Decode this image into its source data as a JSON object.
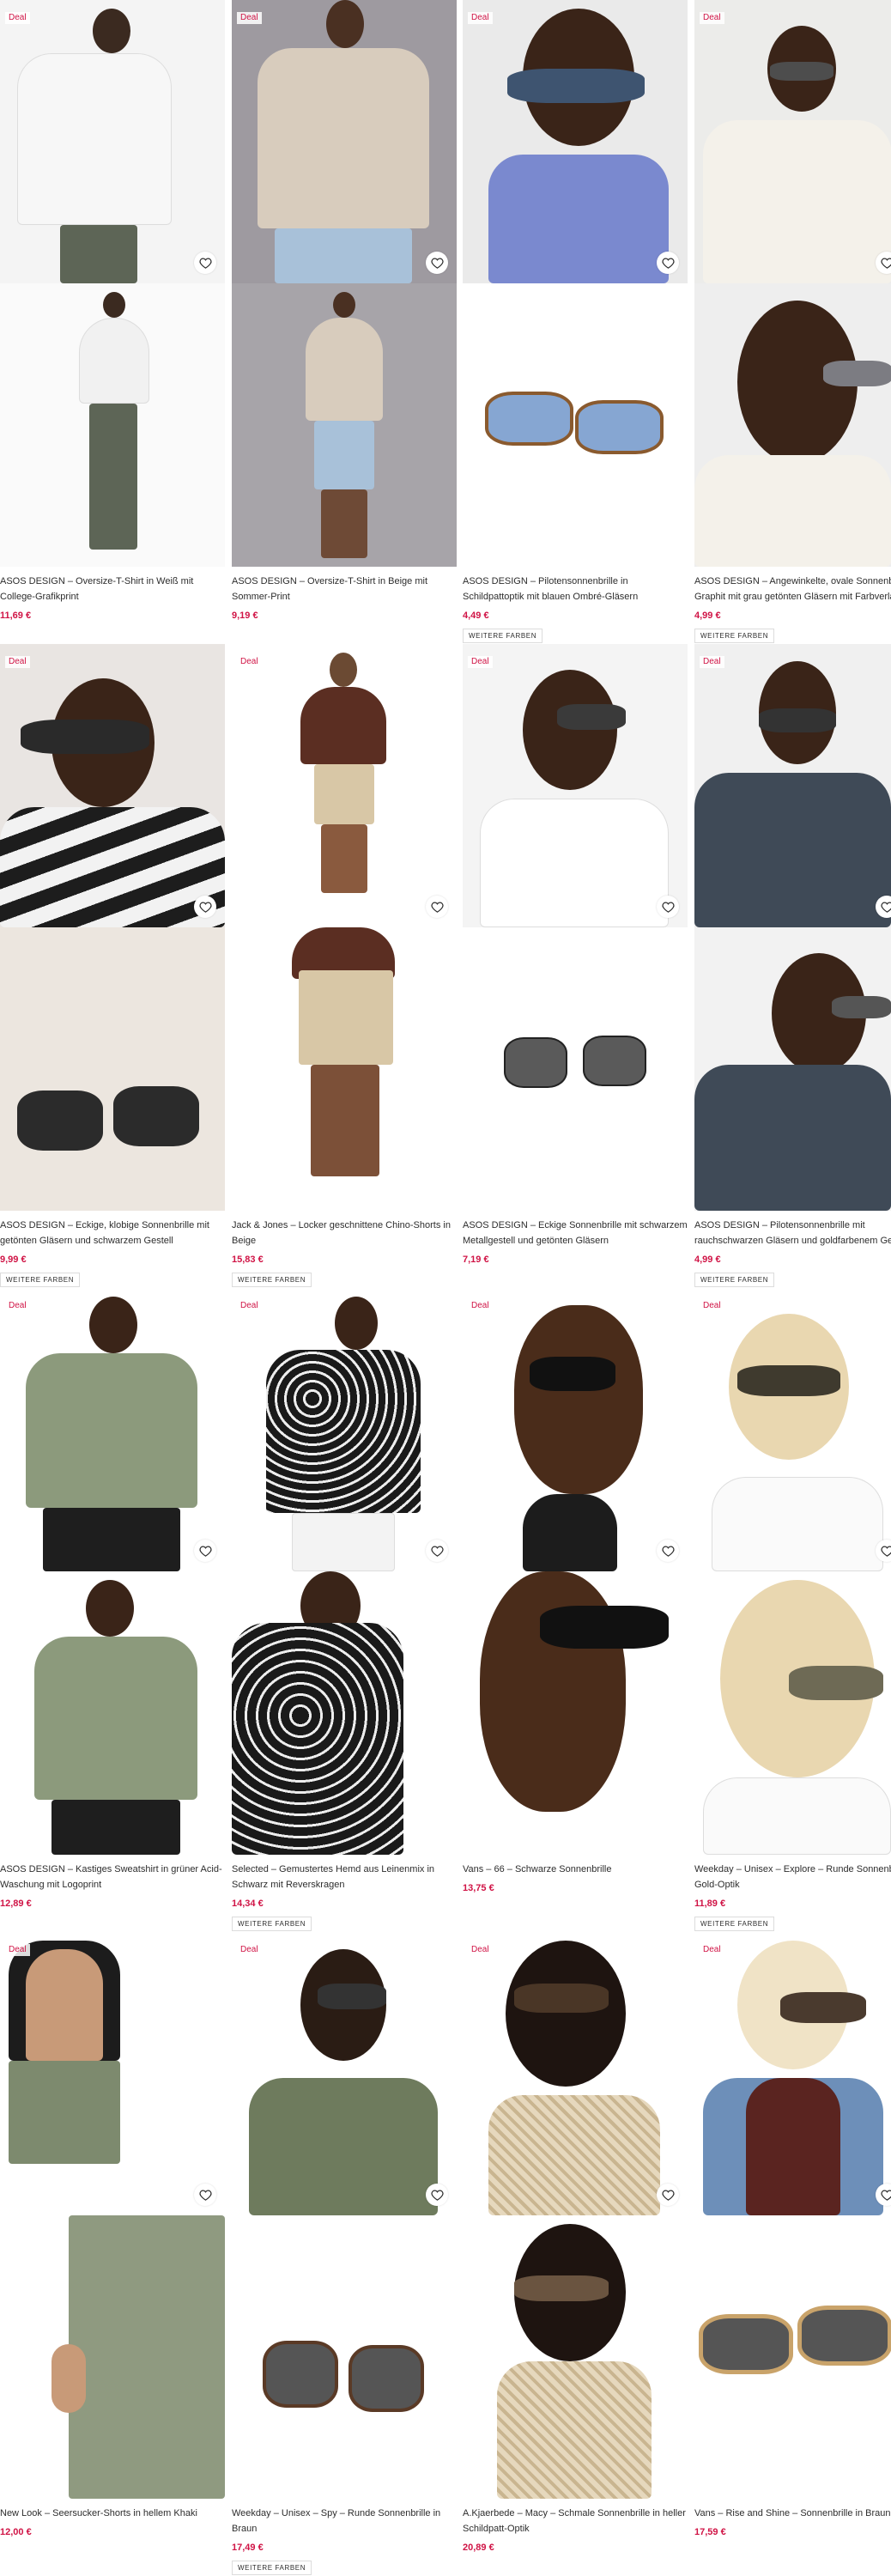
{
  "ui": {
    "deal_label": "Deal",
    "more_colors_label": "WEITERE FARBEN",
    "icons": {
      "wishlist": "heart-outline-icon"
    },
    "colors": {
      "price": "#d01345",
      "deal": "#d01345",
      "text": "#2d2d2d"
    }
  },
  "products": [
    {
      "title": "ASOS DESIGN – Oversize-T-Shirt in Weiß mit College-Grafikprint",
      "price": "11,69 €",
      "deal": true,
      "more_colors": false
    },
    {
      "title": "ASOS DESIGN – Oversize-T-Shirt in Beige mit Sommer-Print",
      "price": "9,19 €",
      "deal": true,
      "more_colors": false
    },
    {
      "title": "ASOS DESIGN – Pilotensonnenbrille in Schildpattoptik mit blauen Ombré-Gläsern",
      "price": "4,49 €",
      "deal": true,
      "more_colors": true
    },
    {
      "title": "ASOS DESIGN – Angewinkelte, ovale Sonnenbrille in Graphit mit grau getönten Gläsern mit Farbverlauf",
      "price": "4,99 €",
      "deal": true,
      "more_colors": true
    },
    {
      "title": "ASOS DESIGN – Eckige, klobige Sonnenbrille mit getönten Gläsern und schwarzem Gestell",
      "price": "9,99 €",
      "deal": true,
      "more_colors": true
    },
    {
      "title": "Jack & Jones – Locker geschnittene Chino-Shorts in Beige",
      "price": "15,83 €",
      "deal": true,
      "more_colors": true
    },
    {
      "title": "ASOS DESIGN – Eckige Sonnenbrille mit schwarzem Metallgestell und getönten Gläsern",
      "price": "7,19 €",
      "deal": true,
      "more_colors": false
    },
    {
      "title": "ASOS DESIGN – Pilotensonnenbrille mit rauchschwarzen Gläsern und goldfarbenem Gestell",
      "price": "4,99 €",
      "deal": true,
      "more_colors": true
    },
    {
      "title": "ASOS DESIGN – Kastiges Sweatshirt in grüner Acid-Waschung mit Logoprint",
      "price": "12,89 €",
      "deal": true,
      "more_colors": false
    },
    {
      "title": "Selected – Gemustertes Hemd aus Leinenmix in Schwarz mit Reverskragen",
      "price": "14,34 €",
      "deal": true,
      "more_colors": true
    },
    {
      "title": "Vans – 66 – Schwarze Sonnenbrille",
      "price": "13,75 €",
      "deal": true,
      "more_colors": false
    },
    {
      "title": "Weekday – Unisex – Explore – Runde Sonnenbrille in Gold-Optik",
      "price": "11,89 €",
      "deal": true,
      "more_colors": true
    },
    {
      "title": "New Look – Seersucker-Shorts in hellem Khaki",
      "price": "12,00 €",
      "deal": true,
      "more_colors": false
    },
    {
      "title": "Weekday – Unisex – Spy – Runde Sonnenbrille in Braun",
      "price": "17,49 €",
      "deal": true,
      "more_colors": true
    },
    {
      "title": "A.Kjaerbede – Macy – Schmale Sonnenbrille in heller Schildpatt-Optik",
      "price": "20,89 €",
      "deal": true,
      "more_colors": false
    },
    {
      "title": "Vans – Rise and Shine – Sonnenbrille in Braun",
      "price": "17,59 €",
      "deal": true,
      "more_colors": false
    }
  ]
}
